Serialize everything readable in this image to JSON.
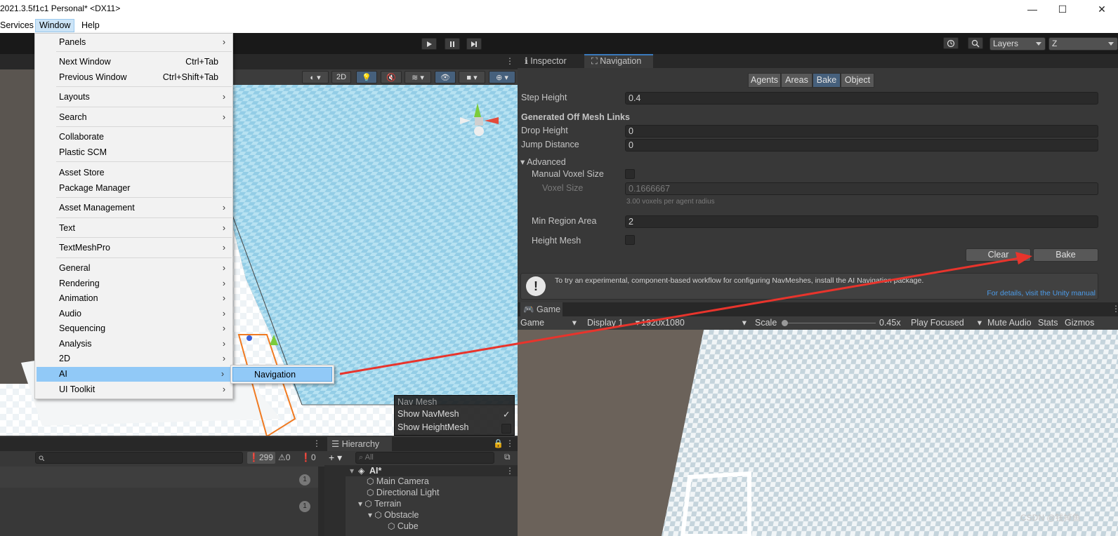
{
  "window": {
    "title": "2021.3.5f1c1 Personal* <DX11>",
    "controls": [
      "—",
      "☐",
      "✕"
    ]
  },
  "menubar": {
    "items": [
      "Services",
      "Window",
      "Help"
    ],
    "active": "Window"
  },
  "toolbar": {
    "layers_label": "Layers",
    "layout_label": "Z"
  },
  "scene_toolbar": {
    "mode_2d": "2D"
  },
  "window_menu": {
    "items": [
      {
        "label": "Panels",
        "shortcut": "",
        "submenu": true
      },
      {
        "label": "Next Window",
        "shortcut": "Ctrl+Tab",
        "submenu": false
      },
      {
        "label": "Previous Window",
        "shortcut": "Ctrl+Shift+Tab",
        "submenu": false
      },
      {
        "label": "Layouts",
        "shortcut": "",
        "submenu": true
      },
      {
        "label": "Search",
        "shortcut": "",
        "submenu": true
      },
      {
        "label": "Collaborate",
        "shortcut": "",
        "submenu": false
      },
      {
        "label": "Plastic SCM",
        "shortcut": "",
        "submenu": false
      },
      {
        "label": "Asset Store",
        "shortcut": "",
        "submenu": false
      },
      {
        "label": "Package Manager",
        "shortcut": "",
        "submenu": false
      },
      {
        "label": "Asset Management",
        "shortcut": "",
        "submenu": true
      },
      {
        "label": "Text",
        "shortcut": "",
        "submenu": true
      },
      {
        "label": "TextMeshPro",
        "shortcut": "",
        "submenu": true
      },
      {
        "label": "General",
        "shortcut": "",
        "submenu": true
      },
      {
        "label": "Rendering",
        "shortcut": "",
        "submenu": true
      },
      {
        "label": "Animation",
        "shortcut": "",
        "submenu": true
      },
      {
        "label": "Audio",
        "shortcut": "",
        "submenu": true
      },
      {
        "label": "Sequencing",
        "shortcut": "",
        "submenu": true
      },
      {
        "label": "Analysis",
        "shortcut": "",
        "submenu": true
      },
      {
        "label": "2D",
        "shortcut": "",
        "submenu": true
      },
      {
        "label": "AI",
        "shortcut": "",
        "submenu": true
      },
      {
        "label": "UI Toolkit",
        "shortcut": "",
        "submenu": true
      }
    ],
    "submenu_ai": {
      "label": "Navigation"
    },
    "arrow": "›"
  },
  "tabs": {
    "inspector": "Inspector",
    "navigation": "Navigation"
  },
  "nav": {
    "segments": [
      "Agents",
      "Areas",
      "Bake",
      "Object"
    ],
    "active_segment": "Bake",
    "step_height_label": "Step Height",
    "step_height": "0.4",
    "offmesh_header": "Generated Off Mesh Links",
    "drop_height_label": "Drop Height",
    "drop_height": "0",
    "jump_distance_label": "Jump Distance",
    "jump_distance": "0",
    "advanced_label": "Advanced",
    "manual_voxel_label": "Manual Voxel Size",
    "voxel_size_label": "Voxel Size",
    "voxel_size": "0.1666667",
    "voxel_hint": "3.00 voxels per agent radius",
    "min_region_label": "Min Region Area",
    "min_region": "2",
    "height_mesh_label": "Height Mesh",
    "clear_label": "Clear",
    "bake_label": "Bake",
    "help_text": "To try an experimental, component-based workflow for configuring NavMeshes, install the AI Navigation package.",
    "help_link": "For details, visit the Unity manual"
  },
  "game": {
    "tab": "Game",
    "mode": "Game",
    "display": "Display 1",
    "resolution": "1920x1080",
    "scale_label": "Scale",
    "scale_value": "0.45x",
    "play_focused": "Play Focused",
    "mute_audio": "Mute Audio",
    "stats": "Stats",
    "gizmos": "Gizmos"
  },
  "navmesh_overlay": {
    "title": "Nav Mesh",
    "show_navmesh": "Show NavMesh",
    "show_heightmesh": "Show HeightMesh"
  },
  "console": {
    "counts": [
      "299",
      "0",
      "0"
    ],
    "row_badges": [
      "1",
      "1"
    ]
  },
  "hierarchy": {
    "tab": "Hierarchy",
    "search_placeholder": "All",
    "items": [
      {
        "label": "AI*"
      },
      {
        "label": "Main Camera"
      },
      {
        "label": "Directional Light"
      },
      {
        "label": "Terrain"
      },
      {
        "label": "Obstacle"
      },
      {
        "label": "Cube"
      }
    ]
  },
  "watermark": "CSDN @钱掉鱼",
  "colors": {
    "accent": "#3a79bb",
    "menu_highlight": "#91c9f7",
    "arrow": "#e8342c"
  }
}
